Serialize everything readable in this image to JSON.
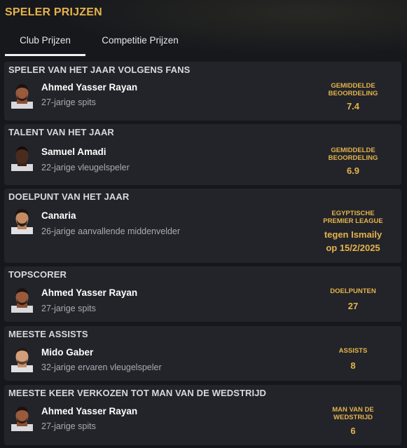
{
  "header": {
    "title": "SPELER PRIJZEN"
  },
  "tabs": [
    {
      "label": "Club Prijzen",
      "active": true
    },
    {
      "label": "Competitie Prijzen",
      "active": false
    }
  ],
  "awards": [
    {
      "title": "SPELER VAN HET JAAR VOLGENS FANS",
      "player": "Ahmed Yasser Rayan",
      "desc": "27-jarige spits",
      "stat_label_1": "GEMIDDELDE",
      "stat_label_2": "BEOORDELING",
      "stat_value": "7.4"
    },
    {
      "title": "TALENT VAN HET JAAR",
      "player": "Samuel Amadi",
      "desc": "22-jarige vleugelspeler",
      "stat_label_1": "GEMIDDELDE",
      "stat_label_2": "BEOORDELING",
      "stat_value": "6.9"
    },
    {
      "title": "DOELPUNT VAN HET JAAR",
      "player": "Canaria",
      "desc": "26-jarige aanvallende middenvelder",
      "stat_label_1": "EGYPTISCHE",
      "stat_label_2": "PREMIER LEAGUE",
      "stat_value_1": "tegen Ismaily",
      "stat_value_2": "op 15/2/2025"
    },
    {
      "title": "TOPSCORER",
      "player": "Ahmed Yasser Rayan",
      "desc": "27-jarige spits",
      "stat_label_1": "DOELPUNTEN",
      "stat_value": "27"
    },
    {
      "title": "MEESTE ASSISTS",
      "player": "Mido Gaber",
      "desc": "32-jarige ervaren vleugelspeler",
      "stat_label_1": "ASSISTS",
      "stat_value": "8"
    },
    {
      "title": "MEESTE KEER VERKOZEN TOT MAN VAN DE WEDSTRIJD",
      "player": "Ahmed Yasser Rayan",
      "desc": "27-jarige spits",
      "stat_label_1": "MAN VAN DE",
      "stat_label_2": "WEDSTRIJD",
      "stat_value": "6"
    }
  ],
  "colors": {
    "accent": "#e6b34a",
    "card_bg": "#22242a",
    "page_bg": "#15171c"
  }
}
